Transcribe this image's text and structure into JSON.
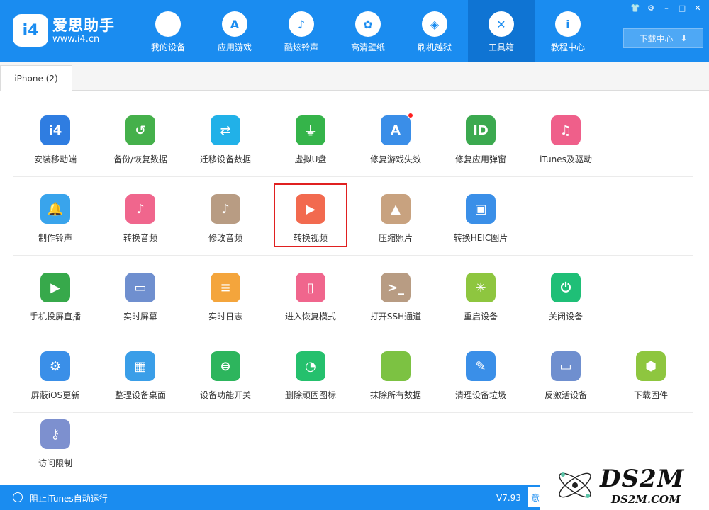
{
  "app": {
    "logo_mark": "i4",
    "title": "爱思助手",
    "url": "www.i4.cn"
  },
  "nav": [
    {
      "label": "我的设备",
      "icon": "apple-icon",
      "glyph": "",
      "active": false
    },
    {
      "label": "应用游戏",
      "icon": "app-store-icon",
      "glyph": "A",
      "active": false
    },
    {
      "label": "酷炫铃声",
      "icon": "bell-icon",
      "glyph": "♪",
      "active": false
    },
    {
      "label": "高清壁纸",
      "icon": "flower-icon",
      "glyph": "✿",
      "active": false
    },
    {
      "label": "刷机越狱",
      "icon": "box-icon",
      "glyph": "◈",
      "active": false
    },
    {
      "label": "工具箱",
      "icon": "tools-icon",
      "glyph": "✕",
      "active": true
    },
    {
      "label": "教程中心",
      "icon": "info-icon",
      "glyph": "i",
      "active": false
    }
  ],
  "window_controls": [
    "👕",
    "⚙",
    "–",
    "□",
    "✕"
  ],
  "download": {
    "label": "下载中心",
    "icon_glyph": "⬇"
  },
  "tab": {
    "label": "iPhone (2)"
  },
  "tools": [
    [
      {
        "label": "安装移动端",
        "icon": "i4-icon",
        "glyph": "i4",
        "color": "#2f7de1"
      },
      {
        "label": "备份/恢复数据",
        "icon": "backup-clock-icon",
        "glyph": "↺",
        "color": "#45b04b"
      },
      {
        "label": "迁移设备数据",
        "icon": "transfer-phones-icon",
        "glyph": "⇄",
        "color": "#21b1e8"
      },
      {
        "label": "虚拟U盘",
        "icon": "usb-drive-icon",
        "glyph": "⏚",
        "color": "#35b44a"
      },
      {
        "label": "修复游戏失效",
        "icon": "app-repair-icon",
        "glyph": "A",
        "color": "#3a8ee8",
        "badge": true
      },
      {
        "label": "修复应用弹窗",
        "icon": "apple-id-icon",
        "glyph": "ID",
        "color": "#3ba94f"
      },
      {
        "label": "iTunes及驱动",
        "icon": "itunes-icon",
        "glyph": "♫",
        "color": "#ef5f8a"
      }
    ],
    [
      {
        "label": "制作铃声",
        "icon": "bell-add-icon",
        "glyph": "🔔",
        "color": "#39a4ec"
      },
      {
        "label": "转换音频",
        "icon": "music-convert-icon",
        "glyph": "♪",
        "color": "#f0668d"
      },
      {
        "label": "修改音频",
        "icon": "music-edit-icon",
        "glyph": "♪",
        "color": "#b89c83"
      },
      {
        "label": "转换视频",
        "icon": "video-play-icon",
        "glyph": "▶",
        "color": "#f26a4f"
      },
      {
        "label": "压缩照片",
        "icon": "photo-icon",
        "glyph": "▲",
        "color": "#c8a27f"
      },
      {
        "label": "转换HEIC图片",
        "icon": "heic-image-icon",
        "glyph": "▣",
        "color": "#3a8fe8"
      }
    ],
    [
      {
        "label": "手机投屏直播",
        "icon": "screen-cast-icon",
        "glyph": "▶",
        "color": "#37a94b"
      },
      {
        "label": "实时屏幕",
        "icon": "monitor-icon",
        "glyph": "▭",
        "color": "#6f8fcf"
      },
      {
        "label": "实时日志",
        "icon": "log-document-icon",
        "glyph": "≡",
        "color": "#f4a53c"
      },
      {
        "label": "进入恢复模式",
        "icon": "recovery-phone-icon",
        "glyph": "▯",
        "color": "#f0668d"
      },
      {
        "label": "打开SSH通道",
        "icon": "terminal-icon",
        "glyph": ">_",
        "color": "#b89c83"
      },
      {
        "label": "重启设备",
        "icon": "restart-icon",
        "glyph": "✳",
        "color": "#8ec63f"
      },
      {
        "label": "关闭设备",
        "icon": "power-icon",
        "glyph": "⏻",
        "color": "#1fbf77"
      }
    ],
    [
      {
        "label": "屏蔽iOS更新",
        "icon": "block-update-icon",
        "glyph": "⚙",
        "color": "#3a8fe8"
      },
      {
        "label": "整理设备桌面",
        "icon": "grid-apps-icon",
        "glyph": "▦",
        "color": "#3a9ee8"
      },
      {
        "label": "设备功能开关",
        "icon": "toggle-switch-icon",
        "glyph": "⊜",
        "color": "#2db55d"
      },
      {
        "label": "删除顽固图标",
        "icon": "pie-delete-icon",
        "glyph": "◔",
        "color": "#25c06d"
      },
      {
        "label": "抹除所有数据",
        "icon": "apple-erase-icon",
        "glyph": "",
        "color": "#7cc242"
      },
      {
        "label": "清理设备垃圾",
        "icon": "broom-icon",
        "glyph": "✎",
        "color": "#3a8fe8"
      },
      {
        "label": "反激活设备",
        "icon": "deactivate-tablet-icon",
        "glyph": "▭",
        "color": "#6f8fcf"
      },
      {
        "label": "下载固件",
        "icon": "firmware-box-icon",
        "glyph": "⬢",
        "color": "#8ec63f"
      }
    ],
    [
      {
        "label": "访问限制",
        "icon": "key-restrict-icon",
        "glyph": "⚷",
        "color": "#7d90cf"
      }
    ]
  ],
  "status": {
    "itunes_block_label": "阻止iTunes自动运行",
    "version": "V7.93",
    "feedback_label": "意"
  },
  "watermark": {
    "main": "DS2M",
    "sub": "DS2M.COM"
  }
}
